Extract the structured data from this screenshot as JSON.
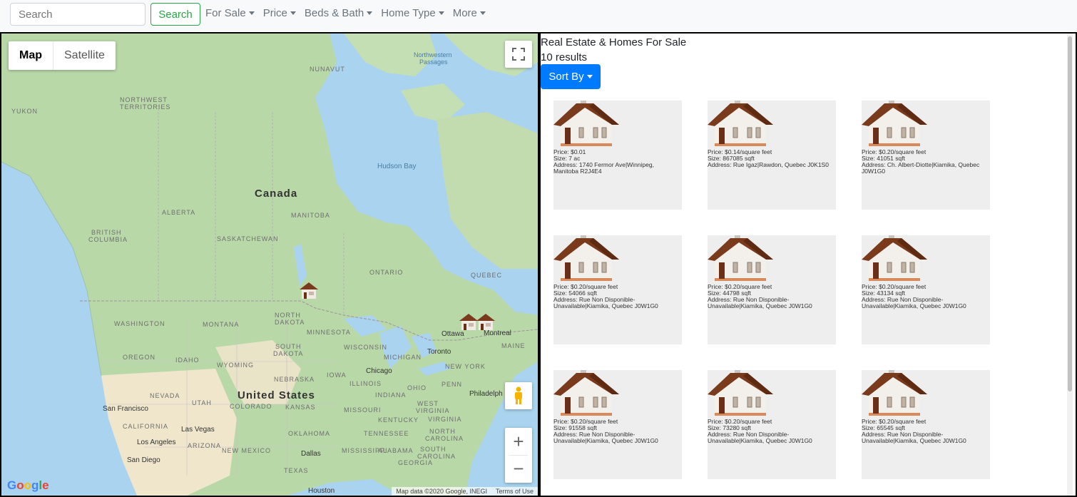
{
  "nav": {
    "search_placeholder": "Search",
    "search_button": "Search",
    "filters": [
      "For Sale",
      "Price",
      "Beds & Bath",
      "Home Type",
      "More"
    ]
  },
  "map": {
    "type_map": "Map",
    "type_satellite": "Satellite",
    "zoom_in": "+",
    "zoom_out": "−",
    "attribution": "Map data ©2020 Google, INEGI",
    "terms": "Terms of Use",
    "logo": "Google",
    "labels": {
      "canada": "Canada",
      "united_states": "United States",
      "hudson_bay": "Hudson Bay",
      "northwestern_passages": "Northwestern",
      "northwestern_passages_2": "Passages",
      "nunavut": "NUNAVUT",
      "northwest_territories": "NORTHWEST",
      "northwest_territories_2": "TERRITORIES",
      "yukon": "YUKON",
      "alberta": "ALBERTA",
      "british_columbia": "BRITISH",
      "british_columbia_2": "COLUMBIA",
      "saskatchewan": "SASKATCHEWAN",
      "manitoba": "MANITOBA",
      "ontario": "ONTARIO",
      "quebec": "QUEBEC",
      "washington": "WASHINGTON",
      "montana": "MONTANA",
      "north_dakota": "NORTH",
      "north_dakota_2": "DAKOTA",
      "minnesota": "MINNESOTA",
      "oregon": "OREGON",
      "idaho": "IDAHO",
      "wyoming": "WYOMING",
      "south_dakota": "SOUTH",
      "south_dakota_2": "DAKOTA",
      "wisconsin": "WISCONSIN",
      "michigan": "MICHIGAN",
      "nebraska": "NEBRASKA",
      "iowa": "IOWA",
      "illinois": "ILLINOIS",
      "nevada": "NEVADA",
      "utah": "UTAH",
      "colorado": "COLORADO",
      "kansas": "KANSAS",
      "missouri": "MISSOURI",
      "indiana": "INDIANA",
      "ohio": "OHIO",
      "california": "CALIFORNIA",
      "arizona": "ARIZONA",
      "new_mexico": "NEW MEXICO",
      "oklahoma": "OKLAHOMA",
      "texas": "TEXAS",
      "kentucky": "KENTUCKY",
      "tennessee": "TENNESSEE",
      "mississippi": "MISSISSIPPI",
      "alabama": "ALABAMA",
      "georgia": "GEORGIA",
      "south_carolina": "SOUTH",
      "south_carolina_2": "CAROLINA",
      "north_carolina": "NORTH",
      "north_carolina_2": "CAROLINA",
      "virginia": "VIRGINIA",
      "west_virginia": "WEST",
      "west_virginia_2": "VIRGINIA",
      "penn": "PENN",
      "new_york": "NEW YORK",
      "maine": "MAINE",
      "san_francisco": "San Francisco",
      "las_vegas": "Las Vegas",
      "los_angeles": "Los Angeles",
      "san_diego": "San Diego",
      "dallas": "Dallas",
      "houston": "Houston",
      "chicago": "Chicago",
      "toronto": "Toronto",
      "ottawa": "Ottawa",
      "montreal": "Montreal",
      "philadelphia": "Philadelph"
    }
  },
  "listings": {
    "title": "Real Estate & Homes For Sale",
    "count": "10 results",
    "sort_button": "Sort By",
    "cards": [
      {
        "price": "Price: $0.01",
        "size": "Size: 7 ac",
        "address": "Address: 1740 Fermor Ave|Winnipeg, Manitoba R2J4E4"
      },
      {
        "price": "Price: $0.14/square feet",
        "size": "Size: 867085 sqft",
        "address": "Address: Rue Igaz|Rawdon, Quebec J0K1S0"
      },
      {
        "price": "Price: $0.20/square feet",
        "size": "Size: 41051 sqft",
        "address": "Address: Ch. Albert-Diotte|Kiamika, Quebec J0W1G0"
      },
      {
        "price": "Price: $0.20/square feet",
        "size": "Size: 54066 sqft",
        "address": "Address: Rue Non Disponible-Unavailable|Kiamika, Quebec J0W1G0"
      },
      {
        "price": "Price: $0.20/square feet",
        "size": "Size: 44798 sqft",
        "address": "Address: Rue Non Disponible-Unavailable|Kiamika, Quebec J0W1G0"
      },
      {
        "price": "Price: $0.20/square feet",
        "size": "Size: 43134 sqft",
        "address": "Address: Rue Non Disponible-Unavailable|Kiamika, Quebec J0W1G0"
      },
      {
        "price": "Price: $0.20/square feet",
        "size": "Size: 91558 sqft",
        "address": "Address: Rue Non Disponible-Unavailable|Kiamika, Quebec J0W1G0"
      },
      {
        "price": "Price: $0.20/square feet",
        "size": "Size: 73280 sqft",
        "address": "Address: Rue Non Disponible-Unavailable|Kiamika, Quebec J0W1G0"
      },
      {
        "price": "Price: $0.20/square feet",
        "size": "Size: 65545 sqft",
        "address": "Address: Rue Non Disponible-Unavailable|Kiamika, Quebec J0W1G0"
      }
    ]
  },
  "colors": {
    "search_green": "#28a745",
    "sort_blue": "#007bff",
    "card_bg": "#eeeeee",
    "water": "#a9d3ee",
    "land_green": "#b9d8a8",
    "land_tan": "#efe6cc"
  }
}
